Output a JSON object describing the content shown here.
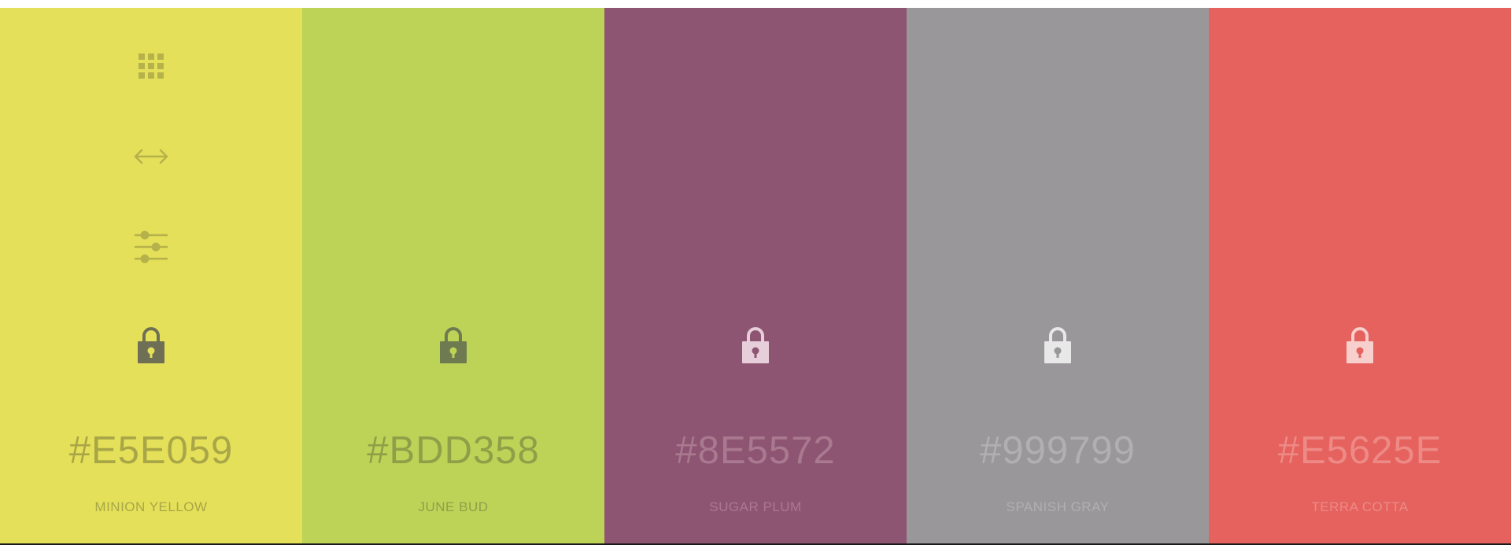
{
  "swatches": [
    {
      "hex": "#E5E059",
      "name": "MINION YELLOW",
      "bg": "#E5E059",
      "text_color": "#A9A648",
      "icon_color": "#B6B24B",
      "lock_color": "#6E6F55",
      "lock_hole": "#E5E059"
    },
    {
      "hex": "#BDD358",
      "name": "JUNE BUD",
      "bg": "#BDD358",
      "text_color": "#8E9F48",
      "lock_color": "#6E7A50",
      "lock_hole": "#BDD358"
    },
    {
      "hex": "#8E5572",
      "name": "SUGAR PLUM",
      "bg": "#8E5572",
      "text_color": "#A9798F",
      "lock_color": "#E6CFDA",
      "lock_hole": "#8E5572"
    },
    {
      "hex": "#999799",
      "name": "SPANISH GRAY",
      "bg": "#999799",
      "text_color": "#B1AFB1",
      "lock_color": "#E9E8E9",
      "lock_hole": "#999799"
    },
    {
      "hex": "#E5625E",
      "name": "TERRA COTTA",
      "bg": "#E5625E",
      "text_color": "#EE8A86",
      "lock_color": "#F7CFCD",
      "lock_hole": "#E5625E"
    }
  ],
  "tools": {
    "grid_icon": "grid-icon",
    "arrows_icon": "horizontal-arrows-icon",
    "adjust_icon": "sliders-icon"
  },
  "strip_color": "#1a1a1a"
}
